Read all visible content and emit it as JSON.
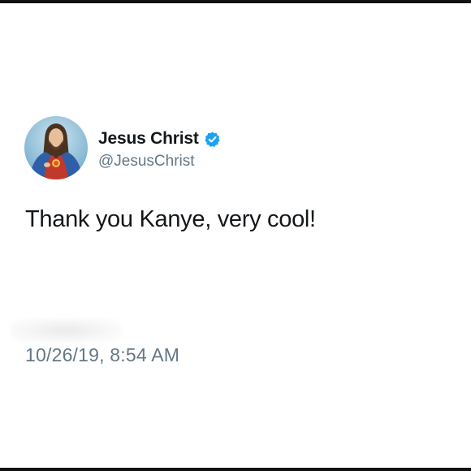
{
  "tweet": {
    "author": {
      "display_name": "Jesus Christ",
      "handle": "@JesusChrist",
      "verified": true,
      "avatar_icon": "religious-portrait-avatar"
    },
    "text": "Thank you Kanye, very cool!",
    "timestamp": "10/26/19, 8:54 AM"
  },
  "colors": {
    "verified_badge": "#1da1f2",
    "name_text": "#14171a",
    "secondary_text": "#657786",
    "background": "#ffffff"
  }
}
